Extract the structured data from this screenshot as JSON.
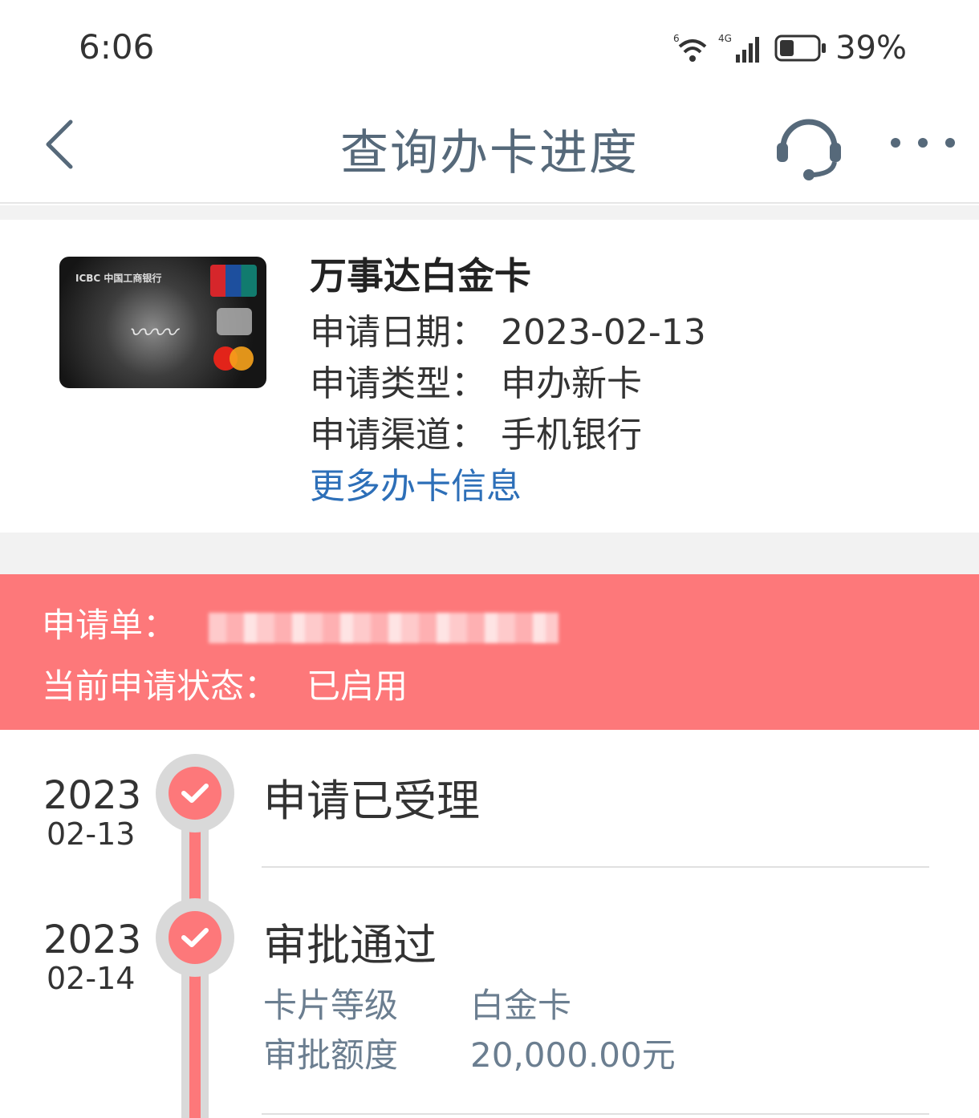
{
  "status_bar": {
    "time": "6:06",
    "wifi_label": "6",
    "network_label": "4G",
    "battery_percent": "39%",
    "battery_level": 0.39
  },
  "header": {
    "title": "查询办卡进度",
    "back_icon": "chevron-left-icon",
    "support_icon": "headset-icon",
    "more_icon": "more-dots-icon"
  },
  "card": {
    "name": "万事达白金卡",
    "image_brand_text": "ICBC 中国工商银行",
    "info": [
      {
        "label": "申请日期：",
        "value": "2023-02-13"
      },
      {
        "label": "申请类型：",
        "value": "申办新卡"
      },
      {
        "label": "申请渠道：",
        "value": "手机银行"
      }
    ],
    "more_link": "更多办卡信息"
  },
  "application": {
    "number_label": "申请单：",
    "status_label": "当前申请状态：",
    "status_value": "已启用"
  },
  "colors": {
    "accent": "#fd787a",
    "title": "#56697a",
    "link": "#2d6fb8",
    "detail": "#6b7e90"
  },
  "timeline": [
    {
      "year": "2023",
      "date": "02-13",
      "title": "申请已受理",
      "details": []
    },
    {
      "year": "2023",
      "date": "02-14",
      "title": "审批通过",
      "details": [
        {
          "label": "卡片等级",
          "value": "白金卡"
        },
        {
          "label": "审批额度",
          "value": "20,000.00元"
        }
      ]
    }
  ]
}
